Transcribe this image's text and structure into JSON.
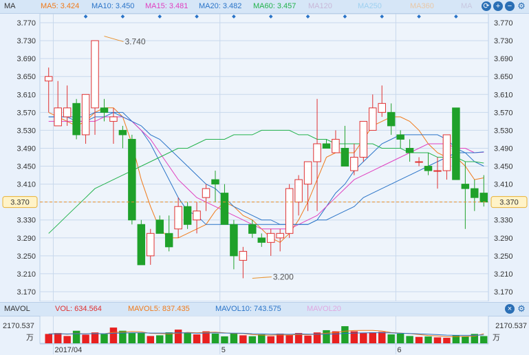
{
  "main_header": {
    "indicator": "MA",
    "items": [
      {
        "label": "MA5: 3.424",
        "color": "#f07a1a"
      },
      {
        "label": "MA10: 3.450",
        "color": "#2a74c8"
      },
      {
        "label": "MA15: 3.481",
        "color": "#e040c0"
      },
      {
        "label": "MA20: 3.482",
        "color": "#2a74c8"
      },
      {
        "label": "MA60: 3.457",
        "color": "#22b24c"
      },
      {
        "label": "MA120",
        "color": "#c8b8d8"
      },
      {
        "label": "MA250",
        "color": "#9ed0f0"
      },
      {
        "label": "MA360",
        "color": "#e8c8a8"
      },
      {
        "label": "MA",
        "color": "#c8c8e0"
      }
    ]
  },
  "vol_header": {
    "indicator": "MAVOL",
    "items": [
      {
        "label": "VOL: 634.564",
        "color": "#e03030"
      },
      {
        "label": "MAVOL5: 837.435",
        "color": "#f07a1a"
      },
      {
        "label": "MAVOL10: 743.575",
        "color": "#2a74c8"
      },
      {
        "label": "MAVOL20",
        "color": "#e0a8e0"
      }
    ]
  },
  "header_buttons": [
    "refresh-icon",
    "plus-icon",
    "minus-icon",
    "gear-icon"
  ],
  "chart_data": [
    {
      "type": "candlestick",
      "ylim": [
        3.17,
        3.79
      ],
      "y_ticks": [
        "3.770",
        "3.730",
        "3.690",
        "3.650",
        "3.610",
        "3.570",
        "3.530",
        "3.490",
        "3.450",
        "3.410",
        "3.370",
        "3.330",
        "3.290",
        "3.250",
        "3.210",
        "3.170"
      ],
      "x_labels": [
        "2017/04",
        "5",
        "6"
      ],
      "x_label_index": [
        1,
        19,
        38
      ],
      "current_price": "3.370",
      "annotations": [
        {
          "text": "3.740",
          "index": 6
        },
        {
          "text": "3.200",
          "index": 22
        }
      ],
      "candles": [
        {
          "o": 3.64,
          "h": 3.67,
          "l": 3.57,
          "c": 3.65
        },
        {
          "o": 3.54,
          "h": 3.64,
          "l": 3.54,
          "c": 3.58
        },
        {
          "o": 3.56,
          "h": 3.63,
          "l": 3.54,
          "c": 3.58
        },
        {
          "o": 3.59,
          "h": 3.6,
          "l": 3.51,
          "c": 3.52
        },
        {
          "o": 3.52,
          "h": 3.58,
          "l": 3.5,
          "c": 3.61
        },
        {
          "o": 3.58,
          "h": 3.62,
          "l": 3.52,
          "c": 3.73
        },
        {
          "o": 3.58,
          "h": 3.6,
          "l": 3.55,
          "c": 3.57
        },
        {
          "o": 3.55,
          "h": 3.58,
          "l": 3.5,
          "c": 3.56
        },
        {
          "o": 3.53,
          "h": 3.54,
          "l": 3.49,
          "c": 3.52
        },
        {
          "o": 3.51,
          "h": 3.52,
          "l": 3.32,
          "c": 3.33
        },
        {
          "o": 3.32,
          "h": 3.33,
          "l": 3.23,
          "c": 3.23
        },
        {
          "o": 3.25,
          "h": 3.31,
          "l": 3.23,
          "c": 3.3
        },
        {
          "o": 3.33,
          "h": 3.34,
          "l": 3.31,
          "c": 3.3
        },
        {
          "o": 3.3,
          "h": 3.34,
          "l": 3.26,
          "c": 3.27
        },
        {
          "o": 3.31,
          "h": 3.38,
          "l": 3.29,
          "c": 3.36
        },
        {
          "o": 3.36,
          "h": 3.37,
          "l": 3.31,
          "c": 3.32
        },
        {
          "o": 3.33,
          "h": 3.37,
          "l": 3.3,
          "c": 3.35
        },
        {
          "o": 3.38,
          "h": 3.41,
          "l": 3.35,
          "c": 3.4
        },
        {
          "o": 3.42,
          "h": 3.44,
          "l": 3.37,
          "c": 3.41
        },
        {
          "o": 3.39,
          "h": 3.41,
          "l": 3.32,
          "c": 3.32
        },
        {
          "o": 3.32,
          "h": 3.33,
          "l": 3.22,
          "c": 3.25
        },
        {
          "o": 3.24,
          "h": 3.27,
          "l": 3.2,
          "c": 3.26
        },
        {
          "o": 3.32,
          "h": 3.33,
          "l": 3.29,
          "c": 3.3
        },
        {
          "o": 3.29,
          "h": 3.3,
          "l": 3.27,
          "c": 3.28
        },
        {
          "o": 3.28,
          "h": 3.31,
          "l": 3.25,
          "c": 3.3
        },
        {
          "o": 3.29,
          "h": 3.31,
          "l": 3.26,
          "c": 3.3
        },
        {
          "o": 3.3,
          "h": 3.41,
          "l": 3.29,
          "c": 3.4
        },
        {
          "o": 3.37,
          "h": 3.43,
          "l": 3.34,
          "c": 3.42
        },
        {
          "o": 3.41,
          "h": 3.46,
          "l": 3.35,
          "c": 3.46
        },
        {
          "o": 3.46,
          "h": 3.6,
          "l": 3.35,
          "c": 3.5
        },
        {
          "o": 3.5,
          "h": 3.51,
          "l": 3.49,
          "c": 3.49
        },
        {
          "o": 3.48,
          "h": 3.53,
          "l": 3.49,
          "c": 3.51
        },
        {
          "o": 3.49,
          "h": 3.54,
          "l": 3.47,
          "c": 3.45
        },
        {
          "o": 3.44,
          "h": 3.5,
          "l": 3.43,
          "c": 3.47
        },
        {
          "o": 3.47,
          "h": 3.55,
          "l": 3.46,
          "c": 3.55
        },
        {
          "o": 3.53,
          "h": 3.61,
          "l": 3.53,
          "c": 3.58
        },
        {
          "o": 3.57,
          "h": 3.63,
          "l": 3.56,
          "c": 3.59
        },
        {
          "o": 3.57,
          "h": 3.59,
          "l": 3.52,
          "c": 3.54
        },
        {
          "o": 3.52,
          "h": 3.53,
          "l": 3.49,
          "c": 3.51
        },
        {
          "o": 3.49,
          "h": 3.51,
          "l": 3.46,
          "c": 3.48
        },
        {
          "o": 3.46,
          "h": 3.47,
          "l": 3.45,
          "c": 3.46
        },
        {
          "o": 3.45,
          "h": 3.48,
          "l": 3.43,
          "c": 3.44
        },
        {
          "o": 3.44,
          "h": 3.47,
          "l": 3.4,
          "c": 3.44
        },
        {
          "o": 3.44,
          "h": 3.51,
          "l": 3.42,
          "c": 3.52
        },
        {
          "o": 3.58,
          "h": 3.58,
          "l": 3.42,
          "c": 3.42
        },
        {
          "o": 3.41,
          "h": 3.46,
          "l": 3.31,
          "c": 3.4
        },
        {
          "o": 3.4,
          "h": 3.42,
          "l": 3.35,
          "c": 3.38
        },
        {
          "o": 3.39,
          "h": 3.43,
          "l": 3.36,
          "c": 3.37
        }
      ],
      "series": [
        {
          "name": "MA5",
          "color": "#f07a1a",
          "values": [
            3.57,
            3.56,
            3.55,
            3.54,
            3.55,
            3.57,
            3.58,
            3.58,
            3.56,
            3.5,
            3.42,
            3.36,
            3.31,
            3.29,
            3.29,
            3.3,
            3.31,
            3.32,
            3.35,
            3.37,
            3.36,
            3.34,
            3.33,
            3.31,
            3.29,
            3.28,
            3.3,
            3.33,
            3.37,
            3.42,
            3.47,
            3.48,
            3.48,
            3.48,
            3.51,
            3.54,
            3.55,
            3.56,
            3.56,
            3.55,
            3.53,
            3.5,
            3.48,
            3.47,
            3.47,
            3.45,
            3.42,
            3.424
          ]
        },
        {
          "name": "MA10",
          "color": "#2a74c8",
          "values": [
            3.56,
            3.56,
            3.56,
            3.55,
            3.55,
            3.56,
            3.56,
            3.57,
            3.57,
            3.55,
            3.53,
            3.5,
            3.46,
            3.42,
            3.38,
            3.35,
            3.34,
            3.32,
            3.32,
            3.32,
            3.32,
            3.32,
            3.32,
            3.32,
            3.32,
            3.32,
            3.32,
            3.32,
            3.32,
            3.33,
            3.36,
            3.39,
            3.41,
            3.44,
            3.46,
            3.48,
            3.5,
            3.51,
            3.52,
            3.52,
            3.52,
            3.52,
            3.52,
            3.51,
            3.49,
            3.48,
            3.46,
            3.45
          ]
        },
        {
          "name": "MA15",
          "color": "#e040c0",
          "values": [
            3.55,
            3.55,
            3.55,
            3.55,
            3.55,
            3.55,
            3.56,
            3.56,
            3.56,
            3.55,
            3.53,
            3.51,
            3.48,
            3.45,
            3.42,
            3.4,
            3.38,
            3.37,
            3.36,
            3.35,
            3.34,
            3.33,
            3.32,
            3.31,
            3.31,
            3.31,
            3.31,
            3.32,
            3.33,
            3.34,
            3.36,
            3.38,
            3.4,
            3.42,
            3.43,
            3.44,
            3.45,
            3.46,
            3.47,
            3.48,
            3.49,
            3.5,
            3.5,
            3.5,
            3.49,
            3.49,
            3.48,
            3.481
          ]
        },
        {
          "name": "MA20",
          "color": "#2a74c8",
          "values": [
            3.56,
            3.56,
            3.56,
            3.56,
            3.56,
            3.57,
            3.57,
            3.57,
            3.56,
            3.55,
            3.54,
            3.52,
            3.51,
            3.49,
            3.47,
            3.45,
            3.43,
            3.41,
            3.4,
            3.38,
            3.36,
            3.35,
            3.34,
            3.33,
            3.33,
            3.32,
            3.32,
            3.32,
            3.32,
            3.33,
            3.33,
            3.34,
            3.35,
            3.36,
            3.38,
            3.39,
            3.4,
            3.41,
            3.42,
            3.43,
            3.44,
            3.45,
            3.46,
            3.47,
            3.48,
            3.48,
            3.48,
            3.482
          ]
        },
        {
          "name": "MA60",
          "color": "#22b24c",
          "values": [
            3.3,
            3.32,
            3.34,
            3.36,
            3.38,
            3.4,
            3.41,
            3.42,
            3.43,
            3.44,
            3.45,
            3.46,
            3.47,
            3.48,
            3.49,
            3.49,
            3.5,
            3.51,
            3.51,
            3.51,
            3.52,
            3.52,
            3.52,
            3.53,
            3.53,
            3.53,
            3.53,
            3.52,
            3.52,
            3.51,
            3.51,
            3.5,
            3.5,
            3.5,
            3.5,
            3.5,
            3.49,
            3.49,
            3.49,
            3.48,
            3.48,
            3.48,
            3.47,
            3.47,
            3.47,
            3.46,
            3.46,
            3.457
          ]
        }
      ]
    },
    {
      "type": "bar",
      "y_ticks": [
        "2170.537"
      ],
      "y_unit": "万",
      "values": [
        820,
        900,
        640,
        1100,
        760,
        950,
        810,
        1380,
        1100,
        900,
        920,
        640,
        700,
        960,
        1200,
        900,
        780,
        1050,
        850,
        610,
        900,
        700,
        620,
        780,
        620,
        850,
        750,
        900,
        680,
        950,
        1150,
        1050,
        1500,
        1050,
        900,
        960,
        1000,
        780,
        850,
        640,
        560,
        600,
        520,
        480,
        720,
        620,
        820,
        634.564
      ],
      "series": [
        {
          "name": "MAVOL5",
          "color": "#f07a1a",
          "values": [
            820,
            860,
            790,
            860,
            840,
            870,
            840,
            960,
            990,
            1030,
            1010,
            870,
            850,
            820,
            880,
            960,
            920,
            960,
            980,
            920,
            860,
            860,
            770,
            720,
            720,
            740,
            720,
            780,
            760,
            800,
            880,
            950,
            1060,
            1120,
            1130,
            1130,
            1080,
            940,
            900,
            850,
            770,
            690,
            650,
            580,
            590,
            600,
            630,
            837.435
          ]
        },
        {
          "name": "MAVOL10",
          "color": "#2a74c8",
          "values": [
            820,
            840,
            820,
            840,
            830,
            850,
            840,
            880,
            900,
            920,
            920,
            900,
            900,
            900,
            920,
            910,
            880,
            900,
            920,
            900,
            890,
            880,
            840,
            830,
            800,
            810,
            790,
            820,
            810,
            800,
            800,
            820,
            870,
            900,
            910,
            930,
            930,
            910,
            880,
            860,
            830,
            800,
            760,
            720,
            700,
            700,
            700,
            743.575
          ]
        }
      ]
    }
  ]
}
